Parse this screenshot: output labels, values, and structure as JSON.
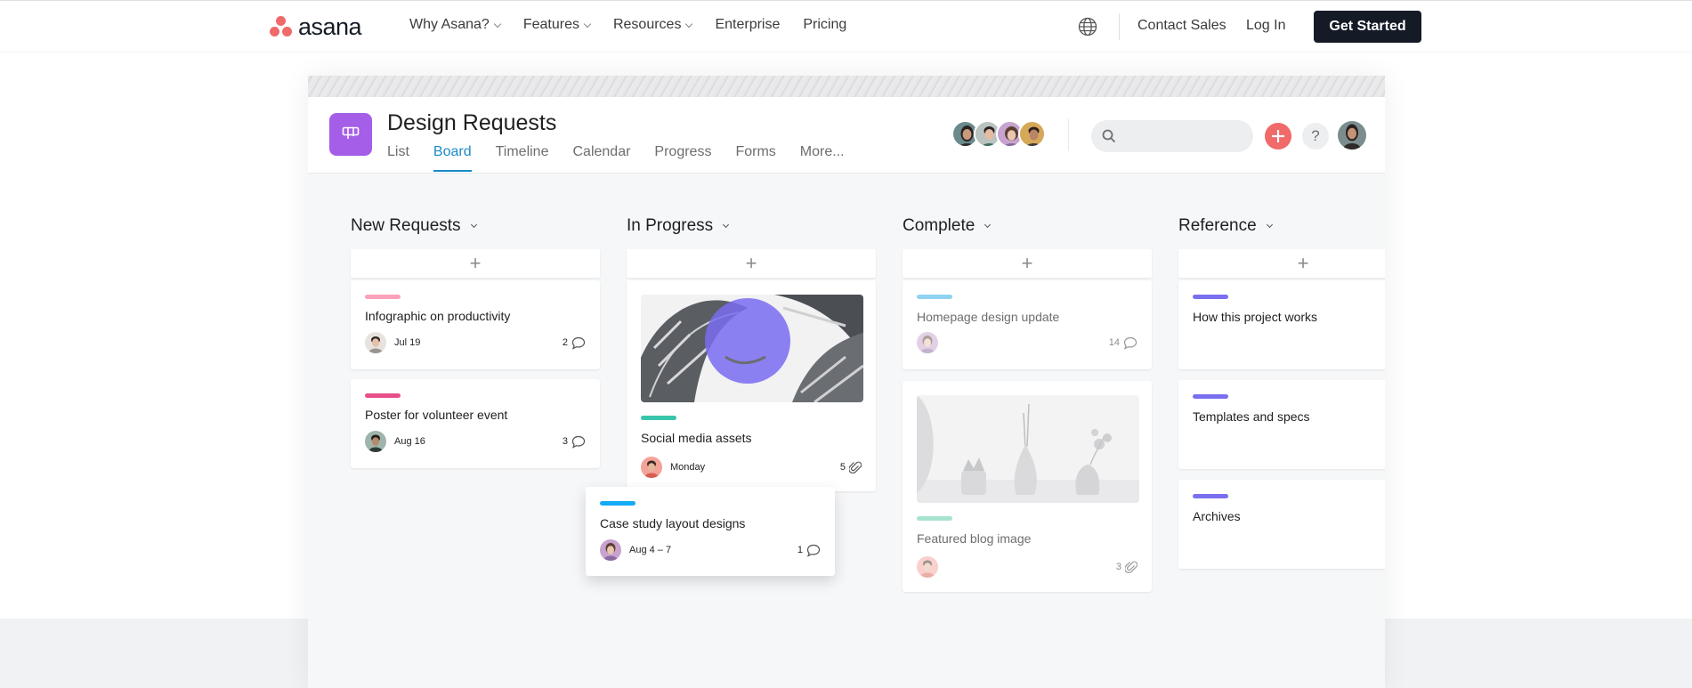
{
  "site_nav": {
    "logo_text": "asana",
    "links": [
      {
        "label": "Why Asana?",
        "has_dropdown": true
      },
      {
        "label": "Features",
        "has_dropdown": true
      },
      {
        "label": "Resources",
        "has_dropdown": true
      },
      {
        "label": "Enterprise",
        "has_dropdown": false
      },
      {
        "label": "Pricing",
        "has_dropdown": false
      }
    ],
    "globe_icon": "globe-icon",
    "contact_sales": "Contact Sales",
    "log_in": "Log In",
    "get_started": "Get Started"
  },
  "project": {
    "title": "Design Requests",
    "icon": "board-icon",
    "icon_color": "#a45ee8",
    "tabs": [
      "List",
      "Board",
      "Timeline",
      "Calendar",
      "Progress",
      "Forms",
      "More..."
    ],
    "active_tab": "Board",
    "member_count_shown": 4,
    "search_placeholder": "",
    "add_button_color": "#f06a6a",
    "help_label": "?"
  },
  "board": {
    "columns": [
      {
        "name": "New Requests",
        "cards": [
          {
            "title": "Infographic on productivity",
            "tag_color": "#f9a2b8",
            "due": "Jul 19",
            "comments": "2"
          },
          {
            "title": "Poster for volunteer event",
            "tag_color": "#e8508a",
            "due": "Aug 16",
            "comments": "3"
          }
        ]
      },
      {
        "name": "In Progress",
        "cards": [
          {
            "title": "Social media assets",
            "tag_color": "#37c5ab",
            "due": "Monday",
            "attachments": "5",
            "has_image": true
          }
        ]
      },
      {
        "name": "Complete",
        "cards": [
          {
            "title": "Homepage design update",
            "tag_color": "#8fd3f0",
            "due": "",
            "comments": "14",
            "completed": true
          },
          {
            "title": "Featured blog image",
            "tag_color": "#a6e3d1",
            "due": "",
            "attachments": "3",
            "has_image": true,
            "completed": true
          }
        ]
      },
      {
        "name": "Reference",
        "cards": [
          {
            "title": "How this project works",
            "tag_color": "#7a6ff0"
          },
          {
            "title": "Templates and specs",
            "tag_color": "#7a6ff0"
          },
          {
            "title": "Archives",
            "tag_color": "#7a6ff0"
          }
        ]
      }
    ],
    "dragged_card": {
      "title": "Case study layout designs",
      "tag_color": "#14aaf5",
      "due": "Aug 4 – 7",
      "comments": "1"
    }
  }
}
